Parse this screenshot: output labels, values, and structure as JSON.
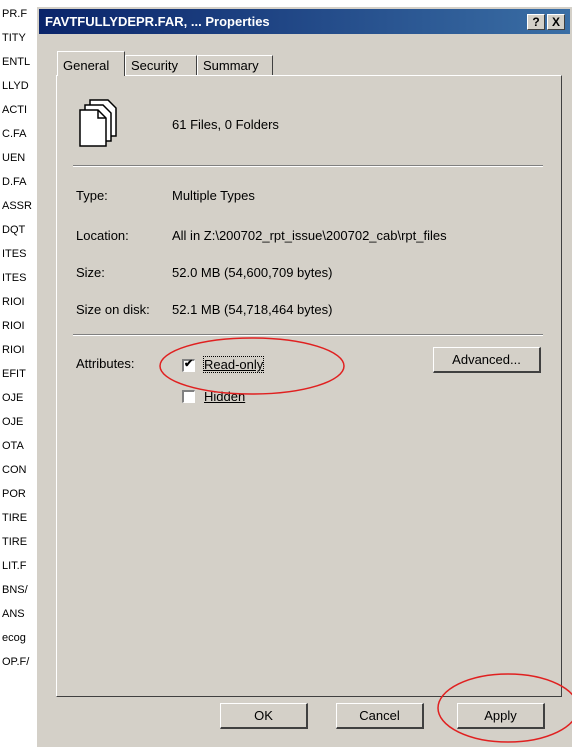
{
  "background_list": [
    "PR.F",
    "TITY",
    "ENTL",
    "LLYD",
    "ACTI",
    "C.FA",
    "UEN",
    "D.FA",
    "ASSR",
    "DQT",
    "ITES",
    "ITES",
    "RIOI",
    "RIOI",
    "RIOI",
    "EFIT",
    "OJE",
    "OJE",
    "OTA",
    "CON",
    "POR",
    "TIRE",
    "TIRE",
    "LIT.F",
    "BNS/",
    "ANS",
    "ecog",
    "OP.F/"
  ],
  "window": {
    "title": "FAVTFULLYDEPR.FAR, ... Properties",
    "help_button": "?",
    "close_button": "X"
  },
  "tabs": [
    {
      "label": "General",
      "active": true
    },
    {
      "label": "Security",
      "active": false
    },
    {
      "label": "Summary",
      "active": false
    }
  ],
  "general": {
    "file_count": "61 Files, 0 Folders",
    "type_label": "Type:",
    "type_value": "Multiple Types",
    "location_label": "Location:",
    "location_value": "All in Z:\\200702_rpt_issue\\200702_cab\\rpt_files",
    "size_label": "Size:",
    "size_value": "52.0 MB (54,600,709 bytes)",
    "size_on_disk_label": "Size on disk:",
    "size_on_disk_value": "52.1 MB (54,718,464 bytes)",
    "attributes_label": "Attributes:",
    "readonly": {
      "label": "Read-only",
      "checked": true
    },
    "hidden": {
      "label": "Hidden",
      "checked": false
    },
    "advanced_button": "Advanced..."
  },
  "buttons": {
    "ok": "OK",
    "cancel": "Cancel",
    "apply": "Apply"
  },
  "annotation_color": "#e02020"
}
